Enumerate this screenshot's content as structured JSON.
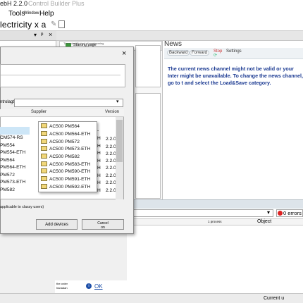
{
  "window": {
    "title_fragment": "ebH 2.2.0",
    "title_ghost": "Control Builder Plus"
  },
  "menu": {
    "tools": "Tools",
    "window": "Window",
    "help": "Help"
  },
  "project": {
    "name": "lectricity x a"
  },
  "pane_controls": {
    "dropdown": "▾",
    "pin": "ᵖ",
    "close": "×"
  },
  "tabs": {
    "starting_page": "Starting page",
    "starting_page_sub": "The scientific tool of engineering"
  },
  "news": {
    "title": "News",
    "back": "Backward",
    "forward": "Forward",
    "stop": "Stop",
    "reset": "Reset",
    "more": "Settings",
    "message": "The current news channel might not be valid or your Inter might be unavailable. To change the news channel, go to t and select the Load&Save category."
  },
  "dialog": {
    "close": "×",
    "catalog_label": "ntrolagt",
    "columns": {
      "supplier": "Supplier",
      "version": "Version"
    },
    "left_rows": [
      "",
      "CM574-RS",
      "PM554",
      "PM554-ETH",
      "PM564",
      "PM564-ETH",
      "PM572",
      "PM573-ETH",
      "PM582"
    ],
    "dropdown_items": [
      "AC500 PM564",
      "AC500 PM564-ETH",
      "AC500 PM572",
      "AC500 PM573-ETH",
      "AC500 PM582",
      "AC500 PM583-ETH",
      "AC500 PM590-ETH",
      "AC500 PM591-ETH",
      "AC500 PM592-ETH"
    ],
    "h_marks": [
      "-",
      "H",
      "H",
      "H",
      "H",
      "H",
      "H",
      "H",
      "H"
    ],
    "versions": [
      "",
      "",
      "",
      "2.2.0",
      "2.2.0",
      "2.2.0",
      "2.2.0",
      "2.2.0",
      "2.2.0"
    ],
    "version_tail": "2.2.0",
    "legacy_note": "applicable to classy users)",
    "add_button": "Add devices",
    "cancel_button": "Cancel",
    "cancel_sub": "on"
  },
  "messages": {
    "errors": "0 errors",
    "col_process": "1 process",
    "col_object": "Object"
  },
  "bottom": {
    "small_label_1": "the order",
    "small_label_2": "hanadan",
    "ok": "OK"
  },
  "status": {
    "current_user": "Current u"
  }
}
